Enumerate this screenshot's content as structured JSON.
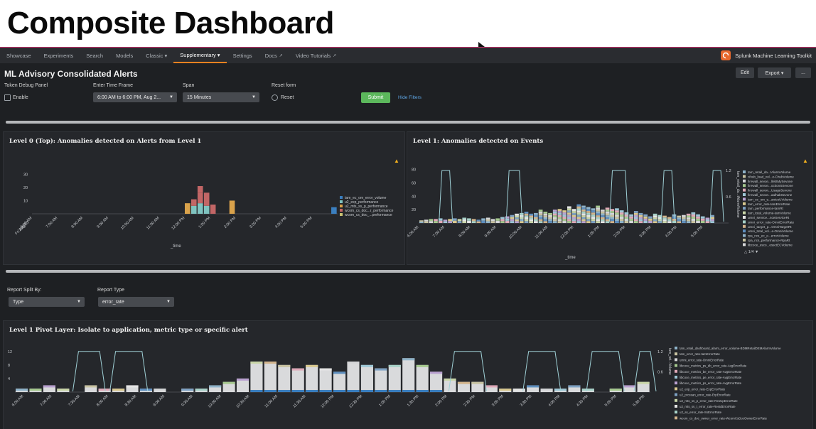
{
  "slide_title": "Composite Dashboard",
  "nav": {
    "items": [
      "Showcase",
      "Experiments",
      "Search",
      "Models",
      "Classic ▾",
      "Supplementary ▾",
      "Settings",
      "Docs",
      "Video Tutorials"
    ],
    "active_index": 5,
    "brand": "Splunk Machine Learning Toolkit"
  },
  "dashboard": {
    "title": "ML Advisory Consolidated Alerts",
    "edit_label": "Edit",
    "export_label": "Export ▾",
    "more_label": "..."
  },
  "inputs": {
    "token_debug": {
      "label": "Token Debug Panel",
      "option": "Enable"
    },
    "time_frame": {
      "label": "Enter Time Frame",
      "value": "6:00 AM to 6:00 PM, Aug 2..."
    },
    "span": {
      "label": "Span",
      "value": "15 Minutes"
    },
    "reset": {
      "label": "Reset form",
      "option": "Reset"
    },
    "submit_label": "Submit",
    "hide_filters_label": "Hide Filters"
  },
  "report": {
    "split_label": "Report Split By:",
    "split_value": "Type",
    "type_label": "Report Type",
    "type_value": "error_rate"
  },
  "panels": {
    "level0_title": "Level 0 (Top): Anomalies detected on Alerts from Level 1",
    "level1_title": "Level 1: Anomalies detected on Events",
    "pivot_title": "Level 1 Pivot Layer: Isolate to application, metric type or specific alert",
    "xlabel": "_time",
    "legend_page": "1/4",
    "right_axis_label_1": "tam_retail_da...tAlarmVolume",
    "right_axis_label_2": "tam_ret...Volume"
  },
  "colors": {
    "accent": "#f58220",
    "submit": "#5cb85c",
    "background": "#1e2023",
    "panel": "#25272b",
    "line": "#9fd0d6"
  },
  "chart_data": [
    {
      "type": "bar",
      "title": "Level 0 (Top): Anomalies detected on Alerts from Level 1",
      "xlabel": "_time",
      "x_ticks": [
        "6:00 AM Fri Aug 23 2019",
        "7:00 AM",
        "8:00 AM",
        "9:00 AM",
        "10:00 AM",
        "11:00 AM",
        "12:00 PM",
        "1:00 PM",
        "2:00 PM",
        "3:00 PM",
        "4:00 PM",
        "5:00 PM"
      ],
      "y_ticks": [
        10,
        20,
        30
      ],
      "ylim": [
        0,
        35
      ],
      "stacked": true,
      "series": [
        {
          "name": "tam_ec_om_error_volume",
          "color": "#3b7fbf"
        },
        {
          "name": "u2_exp_performance",
          "color": "#7fc3c0"
        },
        {
          "name": "u2_mts_ss_p_performance",
          "color": "#d9a24b"
        },
        {
          "name": "wcom_cs_doc...r_performance",
          "color": "#c26666"
        },
        {
          "name": "wcom_cs_doc_...performance",
          "color": "#c9c272"
        }
      ],
      "bars": [
        {
          "x": 12.0,
          "segments": [
            {
              "s": 2,
              "v": 8
            }
          ]
        },
        {
          "x": 12.25,
          "segments": [
            {
              "s": 1,
              "v": 6
            },
            {
              "s": 3,
              "v": 5
            }
          ]
        },
        {
          "x": 12.5,
          "segments": [
            {
              "s": 1,
              "v": 8
            },
            {
              "s": 3,
              "v": 8
            },
            {
              "s": 3,
              "v": 5
            }
          ]
        },
        {
          "x": 12.75,
          "segments": [
            {
              "s": 1,
              "v": 6
            },
            {
              "s": 3,
              "v": 10
            }
          ]
        },
        {
          "x": 13.0,
          "segments": [
            {
              "s": 3,
              "v": 7
            }
          ]
        },
        {
          "x": 13.75,
          "segments": [
            {
              "s": 2,
              "v": 10
            }
          ]
        },
        {
          "x": 17.75,
          "segments": [
            {
              "s": 0,
              "v": 5
            }
          ]
        }
      ]
    },
    {
      "type": "bar",
      "title": "Level 1: Anomalies detected on Events",
      "xlabel": "_time",
      "x_ticks": [
        "6:00 AM Fri Aug 23 2019",
        "7:00 AM",
        "8:00 AM",
        "9:00 AM",
        "10:00 AM",
        "11:00 AM",
        "12:00 PM",
        "1:00 PM",
        "2:00 PM",
        "3:00 PM",
        "4:00 PM",
        "5:00 PM"
      ],
      "y_ticks": [
        20,
        40,
        60,
        80
      ],
      "ylim": [
        0,
        85
      ],
      "y2_ticks": [
        0.6,
        1.2
      ],
      "y2lim": [
        0,
        1.3
      ],
      "stacked": true,
      "totals": [
        4,
        5,
        6,
        6,
        7,
        5,
        6,
        7,
        6,
        8,
        7,
        6,
        5,
        7,
        8,
        6,
        7,
        9,
        10,
        12,
        14,
        15,
        17,
        14,
        15,
        20,
        17,
        15,
        20,
        21,
        19,
        25,
        21,
        28,
        26,
        24,
        22,
        26,
        20,
        23,
        21,
        22,
        19,
        16,
        13,
        18,
        15,
        13,
        10,
        14,
        12,
        11,
        9,
        13,
        11,
        12,
        14,
        16,
        13,
        10,
        8,
        12
      ],
      "legend": [
        "tam_retail_da...tAlarmVolume",
        "cihub_load_vol...e-ChubVolume",
        "firewall_sevon...llebtMySevone",
        "firewall_sevon...octionSSevone",
        "firewall_sevon...UsageSevone",
        "firewall_sevon...aalhabSevone",
        "tam_ec_om_e...antcoUVolume",
        "tam_error_rate-tamErrorRate",
        "tam_performance-tamRt",
        "tam_total_volume-tamVolume",
        "umni_service...nceServiceRt",
        "umni_error_rate-OmniErrorRate",
        "umni_target_p...OmniTargetRt",
        "umni_total_vol...e-OmniVolume",
        "rpa_ncs_ec_e...errorVolume",
        "rpa_ncs_performance-RpaRt",
        "libcoce_esco...essctECVolume"
      ],
      "line_series": {
        "name": "anomaly",
        "color": "#9fd0d6",
        "x_ranges": [
          [
            6.9,
            7.2
          ],
          [
            9.5,
            9.9
          ],
          [
            13.5,
            14.0
          ],
          [
            15.5,
            15.8
          ],
          [
            17.4,
            17.7
          ]
        ]
      }
    },
    {
      "type": "bar",
      "title": "Level 1 Pivot Layer: Isolate to application, metric type or specific alert",
      "xlabel": "",
      "x_ticks": [
        "6:00 AM Fri Aug 23 2019",
        "7:00 AM",
        "7:30 AM",
        "8:00 AM",
        "8:30 AM",
        "9:00 AM",
        "9:30 AM",
        "10:00 AM",
        "10:30 AM",
        "11:00 AM",
        "11:30 AM",
        "12:00 PM",
        "12:30 PM",
        "1:00 PM",
        "1:30 PM",
        "2:00 PM",
        "2:30 PM",
        "3:00 PM",
        "3:30 PM",
        "4:00 PM",
        "4:30 PM",
        "5:00 PM",
        "5:30 PM"
      ],
      "y_ticks": [
        4,
        8,
        12
      ],
      "ylim": [
        0,
        13
      ],
      "y2_ticks": [
        0.6,
        1.2
      ],
      "y2lim": [
        0,
        1.3
      ],
      "stacked": true,
      "totals": [
        1,
        1,
        2,
        1,
        0,
        2,
        1,
        1,
        2,
        1,
        1,
        0,
        1,
        1,
        2,
        3,
        4,
        9,
        9,
        8,
        7,
        8,
        7,
        6,
        9,
        8,
        7,
        8,
        10,
        8,
        6,
        4,
        3,
        3,
        2,
        1,
        1,
        2,
        1,
        1,
        2,
        1,
        0,
        1,
        2,
        3
      ],
      "legend": [
        "tam_retail_dashboard_alarm_error_volume-BDMRetailDEMAlarmVolume",
        "tam_error_rate-tamErrorRate",
        "umni_error_rate-OmniErrorRate",
        "libcoce_metrics_ps_db_error_rate-AvgErrorRate",
        "libcoce_metrics_be_error_rate-AvgErrorRate",
        "libcoce_metrics_pe_error_rate-AvgErrorRate",
        "libcoce_metrics_ps_error_rate-AvgErrorRate",
        "u2_exp_error_rate-ExpErrorRate",
        "u2_prcssan_error_rate-ErpErrorRate",
        "u2_mts_ss_p_error_rate-ResUpErrorRate",
        "u2_mts_ss_t_error_rate-ResIdErrorRate",
        "u2_ss_error_rate-SsErrorRate",
        "wcom_cs_doc_owner_error_rate-WcomCsDocOwnerErrorRate"
      ],
      "line_series": {
        "name": "anomaly",
        "color": "#9fd0d6",
        "x_ranges": [
          [
            7.2,
            7.6
          ],
          [
            7.9,
            8.4
          ],
          [
            14.3,
            14.8
          ],
          [
            15.7,
            16.2
          ],
          [
            16.9,
            17.4
          ],
          [
            17.8,
            18.0
          ]
        ]
      }
    }
  ]
}
